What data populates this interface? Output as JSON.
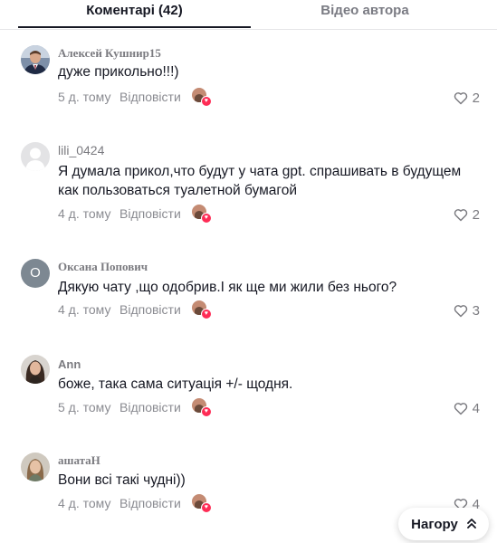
{
  "tabs": [
    {
      "label": "Коментарі (42)",
      "active": true
    },
    {
      "label": "Відео автора",
      "active": false
    }
  ],
  "reply_label": "Відповісти",
  "comments": [
    {
      "author": "Алексей Кушнир15",
      "text": "дуже прикольно!!!)",
      "time": "5 д. тому",
      "likes": "2",
      "avatar": "photo-man-suit"
    },
    {
      "author": "lili_0424",
      "text": "Я думала прикол,что будут у чата gpt. спрашивать в будущем как пользоваться туалетной бумагой",
      "time": "4 д. тому",
      "likes": "2",
      "avatar": "default-user"
    },
    {
      "author": "Оксана Попович",
      "text": "Дякую чату ,що одобрив.І як ще ми жили без нього?",
      "time": "4 д. тому",
      "likes": "3",
      "avatar": "letter",
      "avatar_letter": "О"
    },
    {
      "author": "Ann",
      "text": "боже, така сама ситуація +/- щодня.",
      "time": "5 д. тому",
      "likes": "4",
      "avatar": "photo-woman"
    },
    {
      "author": "ашатаН",
      "text": "Вони всі такі чудні))",
      "time": "4 д. тому",
      "likes": "4",
      "avatar": "photo-woman-light"
    }
  ],
  "back_to_top": {
    "label": "Нагору",
    "icon": "double-chevron-up-icon"
  },
  "colors": {
    "accent": "#fe2c55",
    "text": "#161823",
    "muted": "#8a8b91",
    "letter_avatar": "#7d8892"
  }
}
